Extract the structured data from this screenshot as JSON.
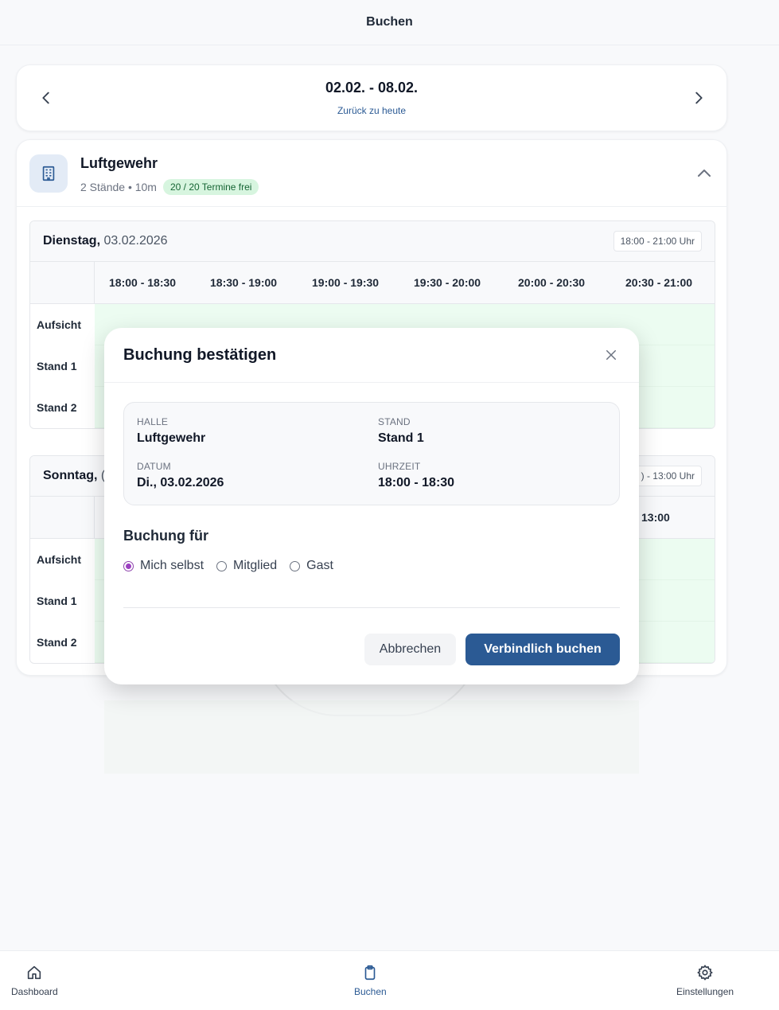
{
  "header": {
    "title": "Buchen"
  },
  "week": {
    "range": "02.02. - 08.02.",
    "back_to_today": "Zurück zu heute"
  },
  "hall": {
    "name": "Luftgewehr",
    "meta": "2 Stände • 10m",
    "badge": "20 / 20 Termine frei",
    "days": [
      {
        "weekday": "Dienstag,",
        "date": "03.02.2026",
        "hours": "18:00 - 21:00 Uhr",
        "slots": [
          "18:00 - 18:30",
          "18:30 - 19:00",
          "19:00 - 19:30",
          "19:30 - 20:00",
          "20:00 - 20:30",
          "20:30 - 21:00"
        ],
        "rows": [
          "Aufsicht",
          "Stand 1",
          "Stand 2"
        ]
      },
      {
        "weekday": "Sonntag,",
        "date": "(",
        "hours": ") - 13:00 Uhr",
        "slot_last": "13:00",
        "rows": [
          "Aufsicht",
          "Stand 1",
          "Stand 2"
        ]
      }
    ]
  },
  "modal": {
    "title": "Buchung bestätigen",
    "info": {
      "hall_key": "HALLE",
      "hall_val": "Luftgewehr",
      "stand_key": "STAND",
      "stand_val": "Stand 1",
      "date_key": "DATUM",
      "date_val": "Di., 03.02.2026",
      "time_key": "UHRZEIT",
      "time_val": "18:00 - 18:30"
    },
    "for_title": "Buchung für",
    "options": [
      "Mich selbst",
      "Mitglied",
      "Gast"
    ],
    "selected": "Mich selbst",
    "cancel_label": "Abbrechen",
    "confirm_label": "Verbindlich buchen"
  },
  "nav": {
    "items": [
      {
        "label": "Dashboard",
        "icon": "home-icon"
      },
      {
        "label": "Buchen",
        "icon": "clipboard-icon"
      },
      {
        "label": "Einstellungen",
        "icon": "gear-icon"
      }
    ],
    "active": "Buchen"
  },
  "colors": {
    "primary": "#2b5a94",
    "free_slot": "#ecfcf1",
    "badge_bg": "#d7f5df",
    "radio_selected": "#9b3fc0"
  }
}
